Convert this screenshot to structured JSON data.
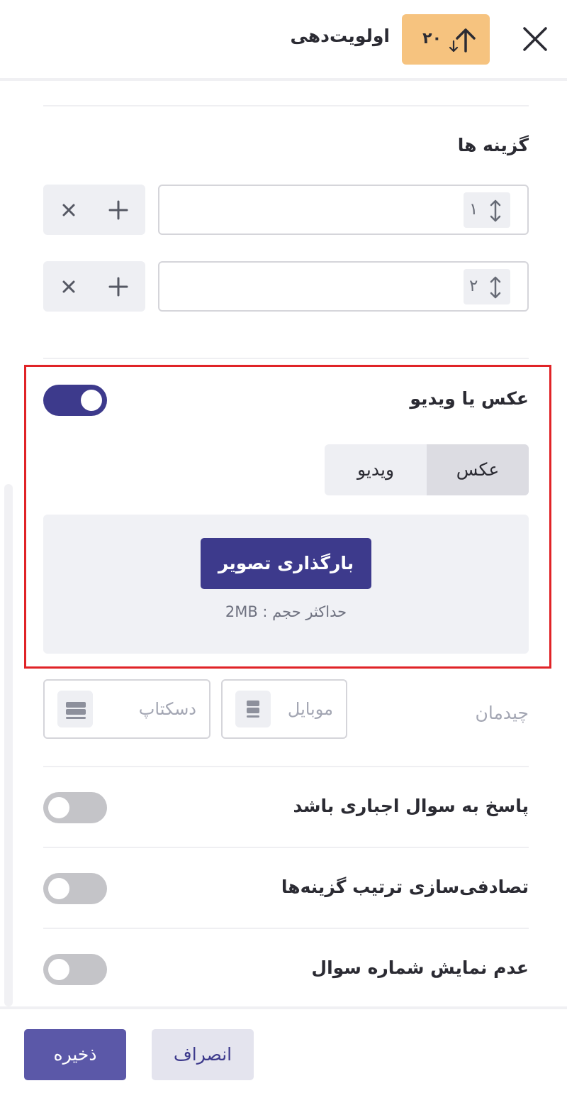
{
  "header": {
    "title": "اولویت‌دهی",
    "badge_number": "۲۰",
    "badge_icon": "priority-sort-icon",
    "close_icon": "close-icon",
    "badge_color": "#f6c37f"
  },
  "options": {
    "title": "گزینه ها",
    "items": [
      {
        "number": "۱",
        "value": ""
      },
      {
        "number": "۲",
        "value": ""
      }
    ],
    "drag_icon": "vertical-arrows-icon",
    "add_icon": "plus-icon",
    "remove_icon": "x-icon"
  },
  "media": {
    "title": "عکس یا ویدیو",
    "enabled": true,
    "tabs": [
      {
        "label": "عکس",
        "active": true
      },
      {
        "label": "ویدیو",
        "active": false
      }
    ],
    "upload_label": "بارگذاری تصویر",
    "max_size_hint": "حداکثر حجم : 2MB",
    "highlight_color": "#e02327"
  },
  "layout": {
    "label": "چیدمان",
    "options": [
      {
        "label": "موبایل",
        "icon": "mobile-layout-icon"
      },
      {
        "label": "دسکتاپ",
        "icon": "desktop-layout-icon"
      }
    ]
  },
  "settings": [
    {
      "label": "پاسخ به سوال اجباری باشد",
      "enabled": false
    },
    {
      "label": "تصادفی‌سازی ترتیب گزینه‌ها",
      "enabled": false
    },
    {
      "label": "عدم نمایش شماره سوال",
      "enabled": false
    }
  ],
  "footer": {
    "save_label": "ذخیره",
    "cancel_label": "انصراف"
  },
  "colors": {
    "primary": "#3d3a8c",
    "save_button": "#5b58a8",
    "toggle_off": "#c4c4c8"
  }
}
